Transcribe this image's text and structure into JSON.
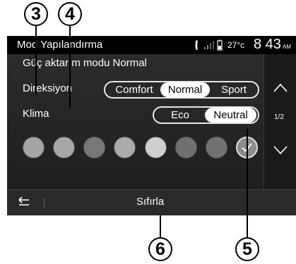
{
  "callouts": {
    "c3": "3",
    "c4": "4",
    "c5": "5",
    "c6": "6"
  },
  "status": {
    "title": "Mod Yapılandırma",
    "temperature": "27°c",
    "time": "8 43",
    "ampm": "AM"
  },
  "main": {
    "subtitle": "Güç aktarım modu Normal",
    "steering": {
      "label": "Direksiyon",
      "options": [
        "Comfort",
        "Normal",
        "Sport"
      ],
      "selected": "Normal"
    },
    "climate": {
      "label": "Klima",
      "options": [
        "Eco",
        "Neutral"
      ],
      "selected": "Neutral"
    },
    "colors": [
      "#a4a4a4",
      "#a8a8a8",
      "#777777",
      "#ababab",
      "#cfcfcf",
      "#707070",
      "#727272",
      "#8c8c8c"
    ],
    "selected_color_index": 7
  },
  "sidebar": {
    "page": "1/2"
  },
  "bottom": {
    "reset_label": "Sıfırla"
  }
}
